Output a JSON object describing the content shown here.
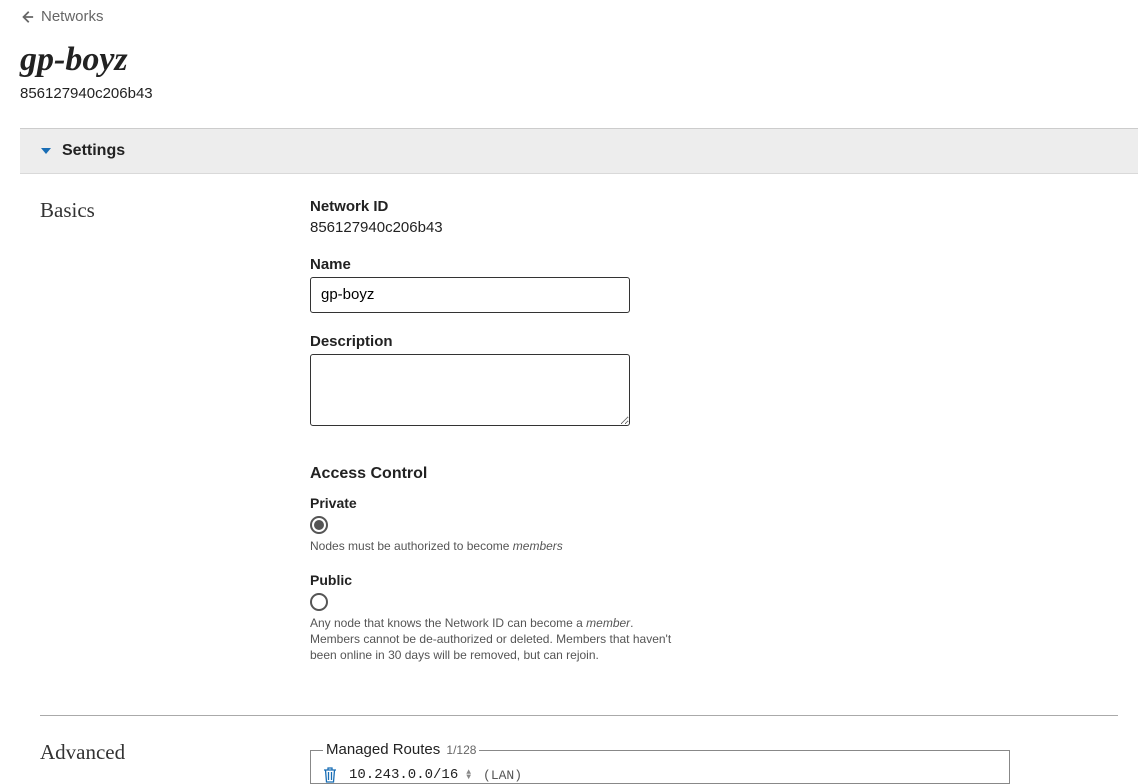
{
  "breadcrumb": {
    "back_label": "Networks"
  },
  "header": {
    "title": "gp-boyz",
    "network_id": "856127940c206b43"
  },
  "panel": {
    "title": "Settings"
  },
  "basics": {
    "section_title": "Basics",
    "network_id_label": "Network ID",
    "network_id_value": "856127940c206b43",
    "name_label": "Name",
    "name_value": "gp-boyz",
    "description_label": "Description",
    "description_value": "",
    "access_control": {
      "heading": "Access Control",
      "private": {
        "label": "Private",
        "selected": true,
        "help_pre": "Nodes must be authorized to become ",
        "help_em": "members"
      },
      "public": {
        "label": "Public",
        "selected": false,
        "help_pre": "Any node that knows the Network ID can become a ",
        "help_em": "member",
        "help_post": ". Members cannot be de-authorized or deleted. Members that haven't been online in 30 days will be removed, but can rejoin."
      }
    }
  },
  "advanced": {
    "section_title": "Advanced",
    "managed_routes": {
      "legend": "Managed Routes",
      "count": "1/128",
      "routes": [
        {
          "destination": "10.243.0.0/16",
          "via_label": "(LAN)"
        }
      ]
    }
  }
}
